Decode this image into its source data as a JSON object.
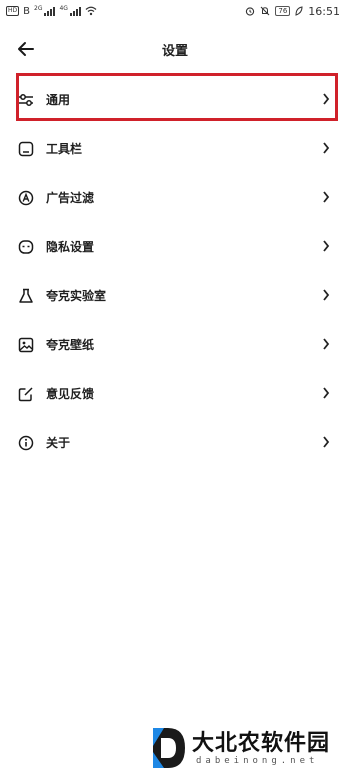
{
  "status_bar": {
    "left_badges": [
      "HD",
      "B"
    ],
    "signal_labels": [
      "2G",
      "4G"
    ],
    "battery": "76",
    "time": "16:51"
  },
  "header": {
    "title": "设置"
  },
  "menu": {
    "items": [
      {
        "label": "通用",
        "icon": "sliders-icon"
      },
      {
        "label": "工具栏",
        "icon": "toolbar-icon"
      },
      {
        "label": "广告过滤",
        "icon": "ad-filter-icon"
      },
      {
        "label": "隐私设置",
        "icon": "privacy-icon"
      },
      {
        "label": "夸克实验室",
        "icon": "flask-icon"
      },
      {
        "label": "夸克壁纸",
        "icon": "image-icon"
      },
      {
        "label": "意见反馈",
        "icon": "feedback-edit-icon"
      },
      {
        "label": "关于",
        "icon": "info-icon"
      }
    ],
    "highlighted_index": 0
  },
  "watermark": {
    "title": "大北农软件园",
    "subtitle": "dabeinong.net"
  },
  "colors": {
    "highlight": "#d0212a",
    "watermark_logo_blue": "#1e88e5",
    "watermark_logo_dark": "#1a1a1a"
  }
}
